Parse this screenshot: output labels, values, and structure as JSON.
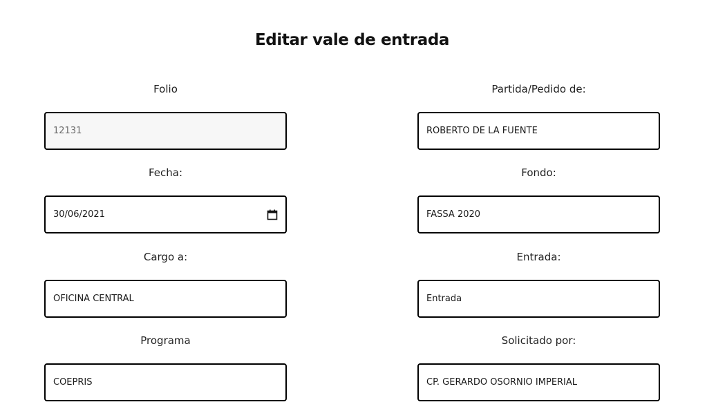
{
  "page": {
    "title": "Editar vale de entrada"
  },
  "fields": {
    "folio": {
      "label": "Folio",
      "value": "12131"
    },
    "partida": {
      "label": "Partida/Pedido de:",
      "value": "ROBERTO DE LA FUENTE"
    },
    "fecha": {
      "label": "Fecha:",
      "value": "30/06/2021",
      "icon": "calendar-icon"
    },
    "fondo": {
      "label": "Fondo:",
      "value": "FASSA 2020"
    },
    "cargo": {
      "label": "Cargo a:",
      "value": "OFICINA CENTRAL"
    },
    "entrada": {
      "label": "Entrada:",
      "value": "Entrada"
    },
    "programa": {
      "label": "Programa",
      "value": "COEPRIS"
    },
    "solicitado": {
      "label": "Solicitado por:",
      "value": "CP. GERARDO OSORNIO IMPERIAL"
    }
  },
  "colors": {
    "border": "#000000",
    "readonly_bg": "#f7f7f7"
  }
}
